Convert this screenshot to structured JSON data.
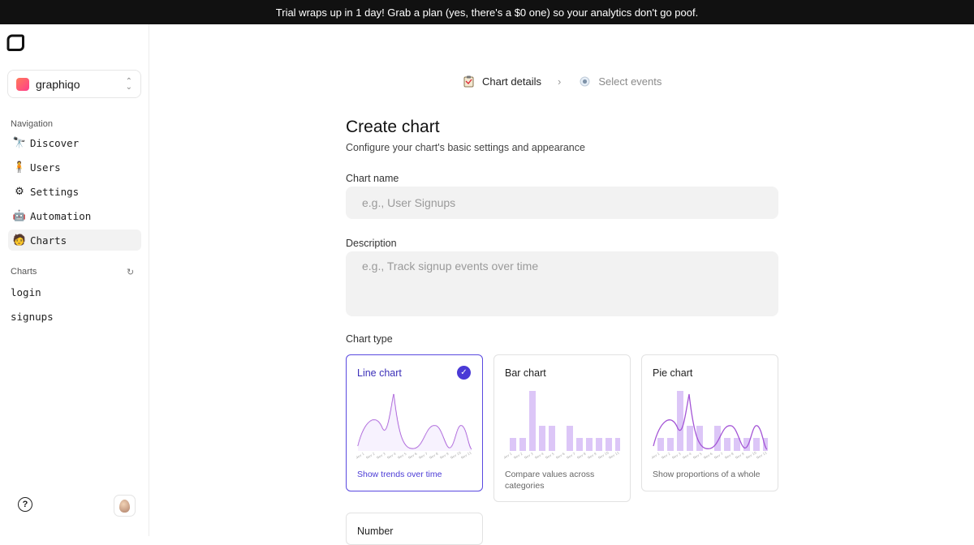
{
  "banner": {
    "text": "Trial wraps up in 1 day! Grab a plan (yes, there's a $0 one) so your analytics don't go poof."
  },
  "workspace": {
    "name": "graphiqo"
  },
  "sidebar": {
    "nav_heading": "Navigation",
    "items": [
      {
        "label": "Discover",
        "icon": "binoculars-icon",
        "glyph": "🔭",
        "active": false
      },
      {
        "label": "Users",
        "icon": "user-icon",
        "glyph": "🧍",
        "active": false
      },
      {
        "label": "Settings",
        "icon": "gear-icon",
        "glyph": "⚙",
        "active": false
      },
      {
        "label": "Automation",
        "icon": "robot-icon",
        "glyph": "🤖",
        "active": false
      },
      {
        "label": "Charts",
        "icon": "chart-figure-icon",
        "glyph": "🧑",
        "active": true
      }
    ],
    "charts_heading": "Charts",
    "charts": [
      "login",
      "signups"
    ]
  },
  "steps": [
    {
      "label": "Chart details",
      "active": true
    },
    {
      "label": "Select events",
      "active": false
    }
  ],
  "page": {
    "title": "Create chart",
    "subtitle": "Configure your chart's basic settings and appearance"
  },
  "form": {
    "name_label": "Chart name",
    "name_placeholder": "e.g., User Signups",
    "name_value": "",
    "description_label": "Description",
    "description_placeholder": "e.g., Track signup events over time",
    "description_value": "",
    "type_label": "Chart type"
  },
  "chart_types": [
    {
      "title": "Line chart",
      "desc": "Show trends over time",
      "selected": true
    },
    {
      "title": "Bar chart",
      "desc": "Compare values across categories",
      "selected": false
    },
    {
      "title": "Pie chart",
      "desc": "Show proportions of a whole",
      "selected": false
    },
    {
      "title": "Number",
      "desc": "",
      "selected": false
    }
  ],
  "colors": {
    "accent": "#4a3ad6",
    "bar": "#dcc6f7",
    "line": "#a455d6"
  }
}
